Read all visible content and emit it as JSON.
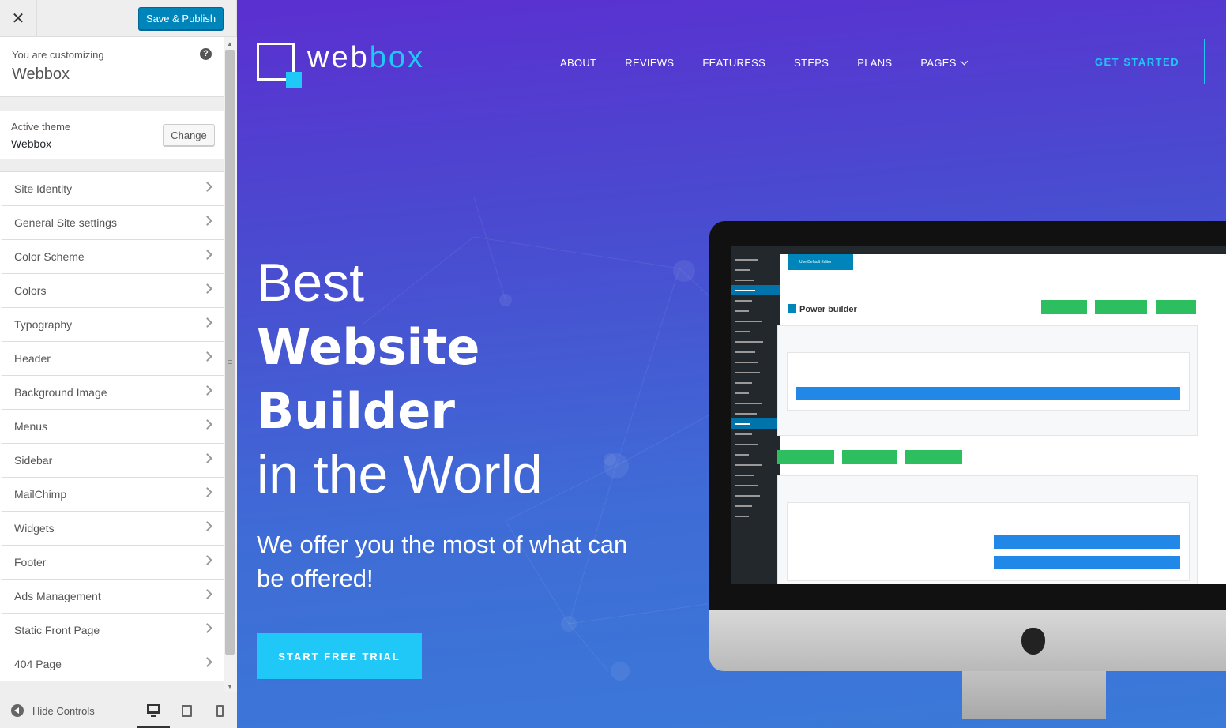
{
  "header": {
    "close_icon": "close-icon",
    "publish_label": "Save & Publish"
  },
  "info": {
    "label": "You are customizing",
    "title": "Webbox",
    "help_icon": "?"
  },
  "theme": {
    "label": "Active theme",
    "name": "Webbox",
    "change_label": "Change"
  },
  "sections": [
    {
      "label": "Site Identity"
    },
    {
      "label": "General Site settings"
    },
    {
      "label": "Color Scheme"
    },
    {
      "label": "Colors"
    },
    {
      "label": "Typography"
    },
    {
      "label": "Header"
    },
    {
      "label": "Background Image"
    },
    {
      "label": "Menus"
    },
    {
      "label": "Sidebar"
    },
    {
      "label": "MailChimp"
    },
    {
      "label": "Widgets"
    },
    {
      "label": "Footer"
    },
    {
      "label": "Ads Management"
    },
    {
      "label": "Static Front Page"
    },
    {
      "label": "404 Page"
    }
  ],
  "footer": {
    "hide_label": "Hide Controls"
  },
  "preview": {
    "logo_part1": "web",
    "logo_part2": "box",
    "nav": [
      "ABOUT",
      "REVIEWS",
      "FEATURESS",
      "STEPS",
      "PLANS",
      "PAGES"
    ],
    "cta_label": "GET STARTED",
    "hero": {
      "line1": "Best",
      "line2": "Website",
      "line3": "Builder",
      "line4": "in the World"
    },
    "subtitle": "We offer you the most of what can be offered!",
    "trial_label": "START FREE TRIAL",
    "mockup": {
      "editor_button": "Use Default Editor",
      "builder_title": "Power builder"
    }
  },
  "colors": {
    "publish_blue": "#0085ba",
    "accent_cyan": "#1fc8f6",
    "hero_gradient_top": "#5b2fd0",
    "hero_gradient_bottom": "#3a7ad8"
  }
}
